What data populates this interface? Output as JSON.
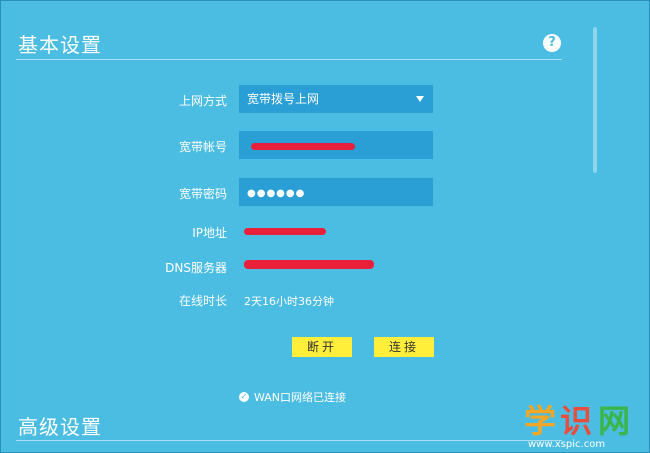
{
  "basic_settings": {
    "title": "基本设置",
    "help_icon": "question-icon",
    "fields": {
      "connection_type": {
        "label": "上网方式",
        "value": "宽带拨号上网"
      },
      "account": {
        "label": "宽带帐号",
        "value": ""
      },
      "password": {
        "label": "宽带密码",
        "value": "●●●●●●"
      }
    },
    "info": {
      "ip": {
        "label": "IP地址",
        "value": ""
      },
      "dns": {
        "label": "DNS服务器",
        "value": ""
      },
      "uptime": {
        "label": "在线时长",
        "value": "2天16小时36分钟"
      }
    },
    "buttons": {
      "disconnect": "断开",
      "connect": "连接"
    },
    "status": "WAN口网络已连接"
  },
  "advanced_settings": {
    "title": "高级设置"
  },
  "watermark": {
    "text": "学识网",
    "url": "www.xspic.com"
  },
  "colors": {
    "background": "#4bbde3",
    "field": "#2a9fd6",
    "button": "#ffef3a",
    "redaction": "#e8203a"
  }
}
